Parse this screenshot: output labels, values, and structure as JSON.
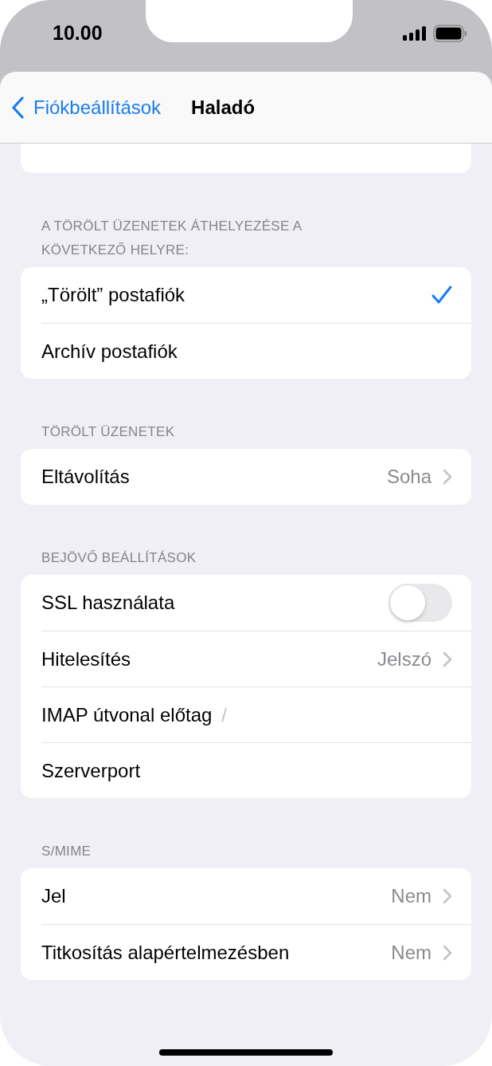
{
  "status_bar": {
    "time": "10.00"
  },
  "nav": {
    "back": "Fiókbeállítások",
    "title": "Haladó"
  },
  "sections": [
    {
      "header": "A TÖRÖLT ÜZENETEK ÁTHELYEZÉSE A KÖVETKEZŐ HELYRE:",
      "rows": [
        {
          "kind": "choice",
          "label": "„Törölt” postafiók",
          "selected": true
        },
        {
          "kind": "choice",
          "label": "Archív postafiók",
          "selected": false
        }
      ]
    },
    {
      "header": "TÖRÖLT ÜZENETEK",
      "rows": [
        {
          "kind": "link",
          "label": "Eltávolítás",
          "value": "Soha"
        }
      ]
    },
    {
      "header": "BEJÖVŐ BEÁLLÍTÁSOK",
      "rows": [
        {
          "kind": "toggle",
          "label": "SSL használata",
          "on": false
        },
        {
          "kind": "link",
          "label": "Hitelesítés",
          "value": "Jelszó"
        },
        {
          "kind": "field",
          "label": "IMAP útvonal előtag",
          "placeholder": "/"
        },
        {
          "kind": "field",
          "label": "Szerverport"
        }
      ]
    },
    {
      "header": "S/MIME",
      "rows": [
        {
          "kind": "link",
          "label": "Jel",
          "value": "Nem"
        },
        {
          "kind": "link",
          "label": "Titkosítás alapértelmezésben",
          "value": "Nem"
        }
      ]
    }
  ]
}
